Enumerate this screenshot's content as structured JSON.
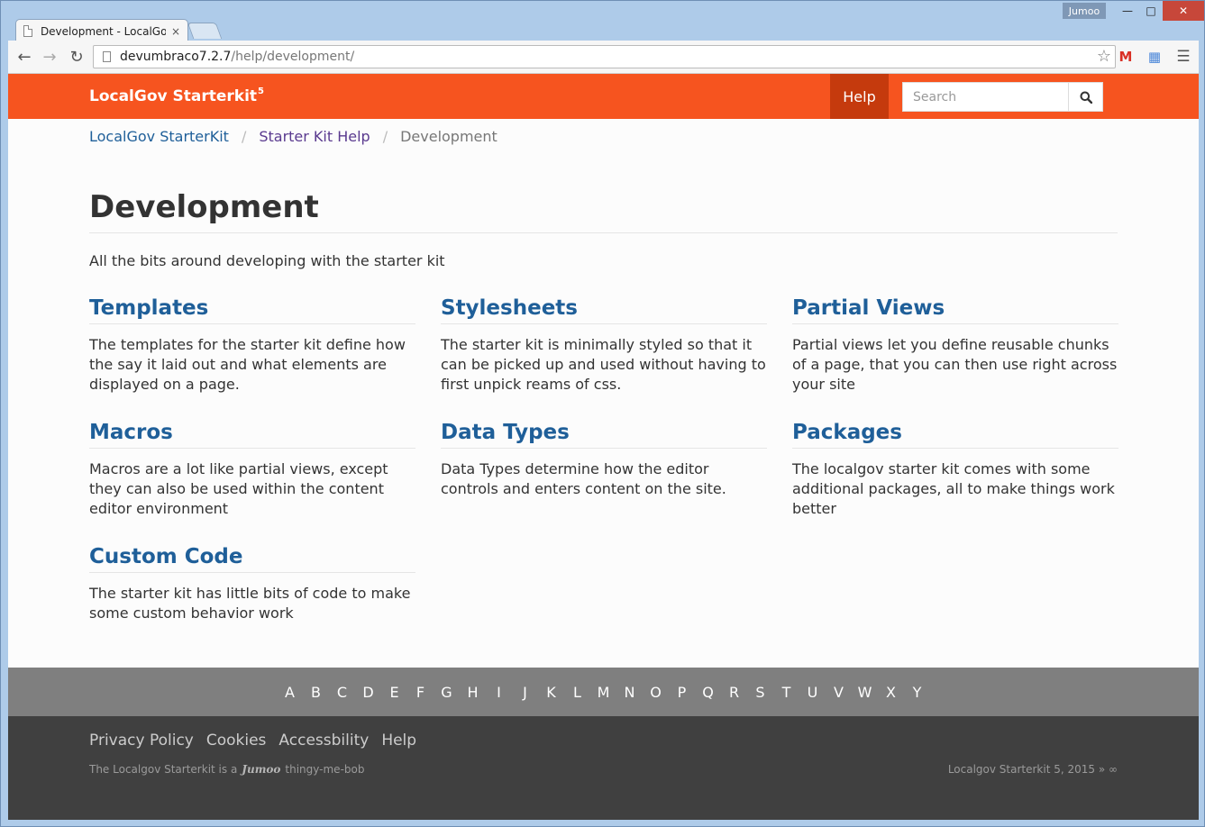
{
  "browser": {
    "tab_title": "Development - LocalGov S",
    "tab_close": "×",
    "profile_name": "Jumoo",
    "url_host": "devumbraco7.2.7",
    "url_path": "/help/development/"
  },
  "header": {
    "brand": "LocalGov Starterkit",
    "brand_sup": "5",
    "nav_help": "Help",
    "search_placeholder": "Search"
  },
  "breadcrumb": {
    "items": [
      "LocalGov StarterKit",
      "Starter Kit Help"
    ],
    "separator": "/",
    "current": "Development"
  },
  "main": {
    "title": "Development",
    "intro": "All the bits around developing with the starter kit",
    "cards": [
      {
        "title": "Templates",
        "text": "The templates for the starter kit define how the say it laid out and what elements are displayed on a page."
      },
      {
        "title": "Stylesheets",
        "text": "The starter kit is minimally styled so that it can be picked up and used without having to first unpick reams of css."
      },
      {
        "title": "Partial Views",
        "text": "Partial views let you define reusable chunks of a page, that you can then use right across your site"
      },
      {
        "title": "Macros",
        "text": "Macros are a lot like partial views, except they can also be used within the content editor environment"
      },
      {
        "title": "Data Types",
        "text": "Data Types determine how the editor controls and enters content on the site."
      },
      {
        "title": "Packages",
        "text": "The localgov starter kit comes with some additional packages, all to make things work better"
      },
      {
        "title": "Custom Code",
        "text": "The starter kit has little bits of code to make some custom behavior work"
      }
    ]
  },
  "az": [
    "A",
    "B",
    "C",
    "D",
    "E",
    "F",
    "G",
    "H",
    "I",
    "J",
    "K",
    "L",
    "M",
    "N",
    "O",
    "P",
    "Q",
    "R",
    "S",
    "T",
    "U",
    "V",
    "W",
    "X",
    "Y"
  ],
  "footer": {
    "links": [
      "Privacy Policy",
      "Cookies",
      "Accessbility",
      "Help"
    ],
    "tag_prefix": "The Localgov Starterkit is a",
    "tag_logo": "Jumoo",
    "tag_suffix": "thingy-me-bob",
    "copyright": "Localgov Starterkit 5, 2015 » ∞"
  },
  "colors": {
    "brand_orange": "#f6541f",
    "help_active": "#c53a0d",
    "link_blue": "#1f5f99",
    "az_bar": "#7f7f7f",
    "footer_bg": "#404040"
  }
}
